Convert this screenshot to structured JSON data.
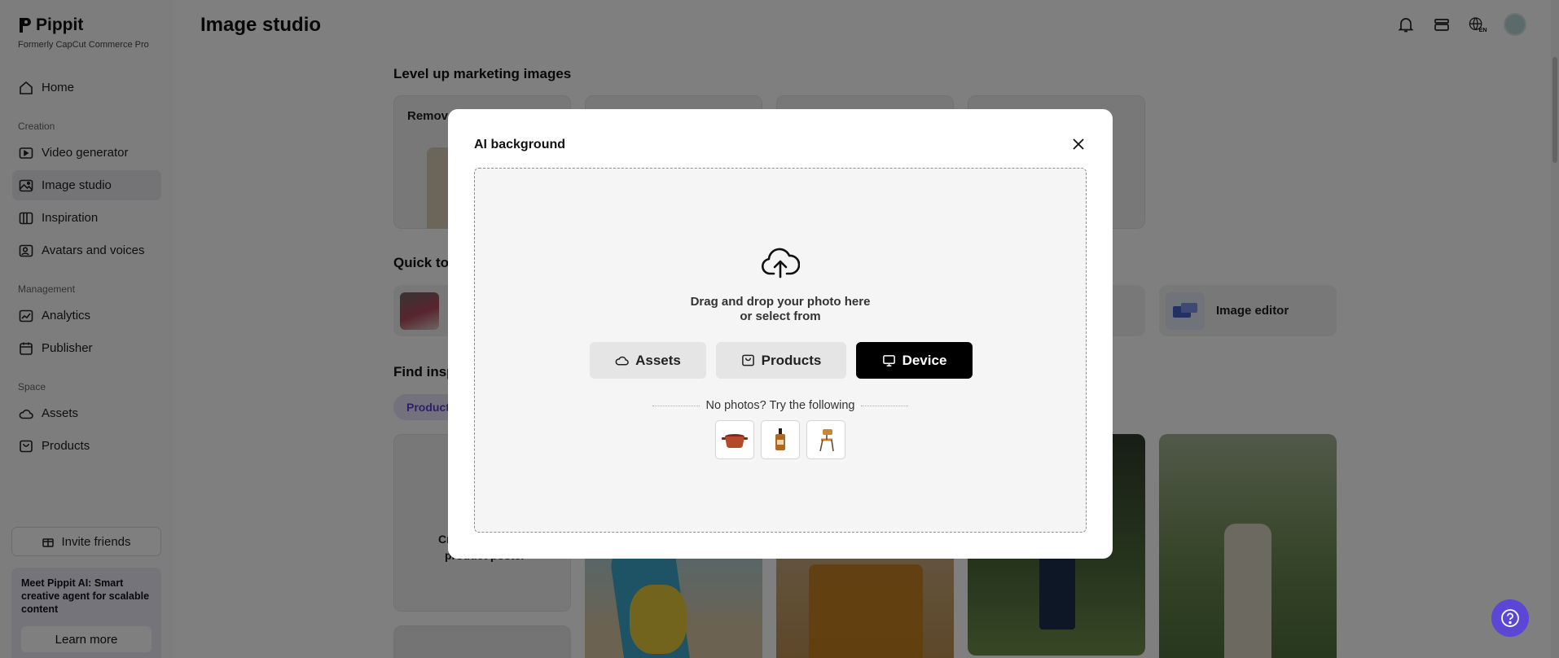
{
  "app": {
    "name": "Pippit",
    "subtitle": "Formerly CapCut Commerce Pro",
    "page_title": "Image studio"
  },
  "sidebar": {
    "items": [
      {
        "label": "Home",
        "icon": "home-icon"
      },
      {
        "label": "Video generator",
        "icon": "video-generator-icon"
      },
      {
        "label": "Image studio",
        "icon": "image-studio-icon",
        "active": true
      },
      {
        "label": "Inspiration",
        "icon": "inspiration-icon"
      },
      {
        "label": "Avatars and voices",
        "icon": "avatar-voice-icon"
      },
      {
        "label": "Analytics",
        "icon": "analytics-icon"
      },
      {
        "label": "Publisher",
        "icon": "calendar-icon"
      },
      {
        "label": "Assets",
        "icon": "cloud-icon"
      },
      {
        "label": "Products",
        "icon": "bag-icon"
      }
    ],
    "sections": {
      "creation": "Creation",
      "management": "Management",
      "space": "Space"
    },
    "invite_label": "Invite friends",
    "promo_text": "Meet Pippit AI: Smart creative agent for scalable content",
    "learn_more": "Learn more"
  },
  "main": {
    "section1": "Level up marketing images",
    "card1_title": "Remove",
    "section2": "Quick to",
    "tool_last": "Image editor",
    "section3": "Find insp",
    "filter_pill": "Product",
    "create_card_text_1": "Cr",
    "create_card_text_2": "product poster"
  },
  "modal": {
    "title": "AI background",
    "drop_line1": "Drag and drop your photo here",
    "drop_line2": "or select from",
    "buttons": {
      "assets": "Assets",
      "products": "Products",
      "device": "Device"
    },
    "try_text": "No photos? Try the following",
    "samples": [
      "pot-sample",
      "bottle-sample",
      "chair-sample"
    ]
  },
  "colors": {
    "accent": "#5b46d6",
    "overlay": "rgba(0,0,0,0.5)",
    "device_button": "#000000"
  }
}
